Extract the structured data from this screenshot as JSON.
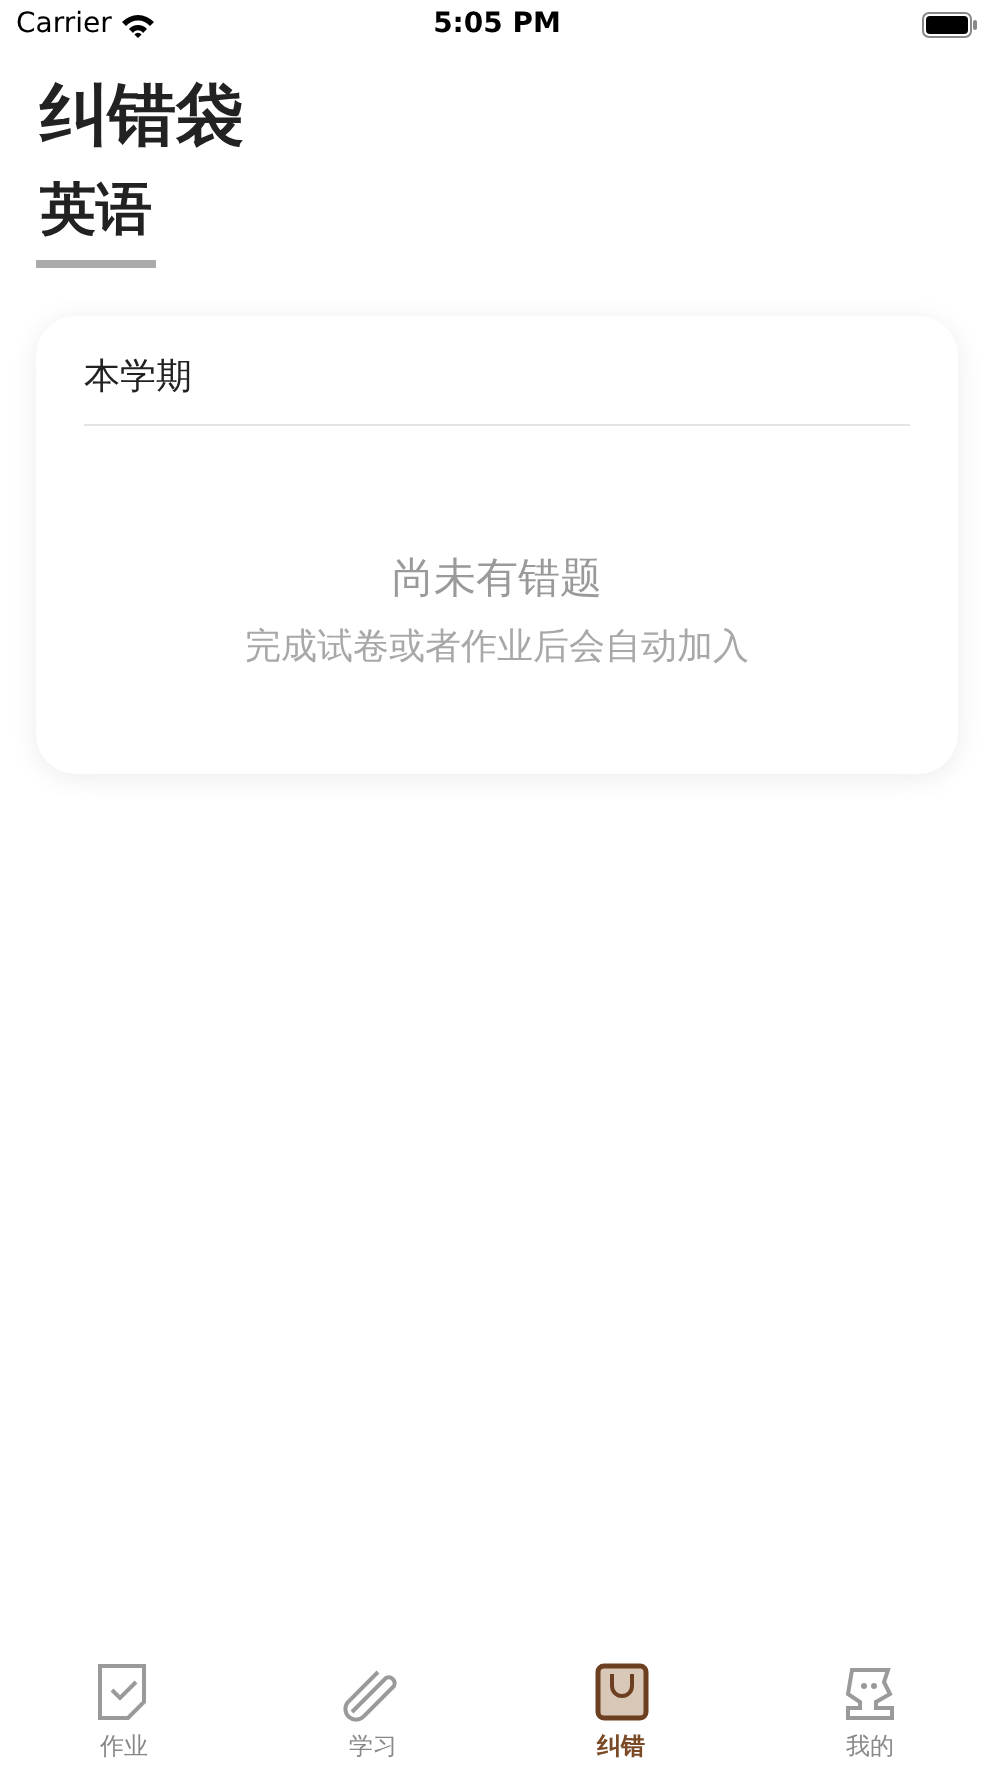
{
  "status_bar": {
    "carrier": "Carrier",
    "time": "5:05 PM"
  },
  "title": "纠错袋",
  "subjects": [
    {
      "label": "英语",
      "selected": true
    }
  ],
  "card": {
    "heading": "本学期",
    "empty_title": "尚未有错题",
    "empty_hint": "完成试卷或者作业后会自动加入"
  },
  "tab_bar": [
    {
      "label": "作业",
      "kind": "homework",
      "selected": false
    },
    {
      "label": "学习",
      "kind": "study",
      "selected": false
    },
    {
      "label": "纠错",
      "kind": "bag",
      "selected": true
    },
    {
      "label": "我的",
      "kind": "profile",
      "selected": false
    }
  ]
}
